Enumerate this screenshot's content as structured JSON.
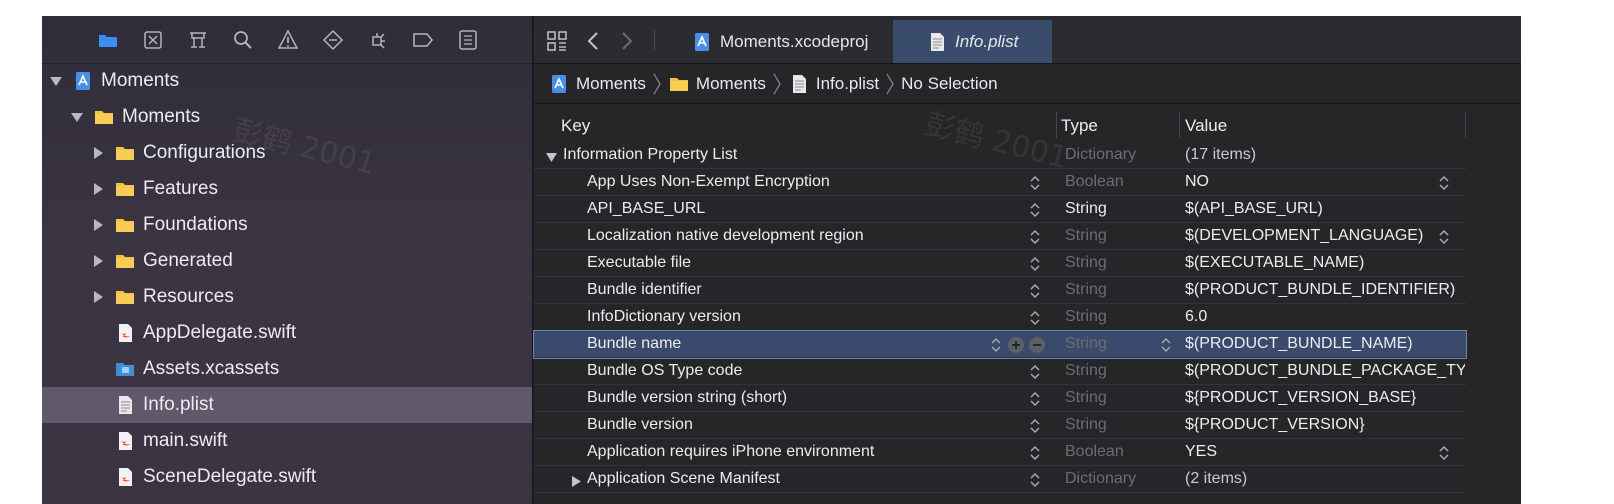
{
  "navigator": {
    "toolbar_icons": [
      "folder-icon",
      "source-control-icon",
      "symbol-icon",
      "find-icon",
      "issue-warning-icon",
      "test-icon",
      "debug-icon",
      "breakpoint-icon",
      "report-icon"
    ],
    "tree": [
      {
        "label": "Moments",
        "icon": "project-icon",
        "expanded": true,
        "level": 0
      },
      {
        "label": "Moments",
        "icon": "folder-icon",
        "expanded": true,
        "level": 1
      },
      {
        "label": "Configurations",
        "icon": "folder-icon",
        "expanded": false,
        "level": 2
      },
      {
        "label": "Features",
        "icon": "folder-icon",
        "expanded": false,
        "level": 2
      },
      {
        "label": "Foundations",
        "icon": "folder-icon",
        "expanded": false,
        "level": 2
      },
      {
        "label": "Generated",
        "icon": "folder-icon",
        "expanded": false,
        "level": 2
      },
      {
        "label": "Resources",
        "icon": "folder-icon",
        "expanded": false,
        "level": 2
      },
      {
        "label": "AppDelegate.swift",
        "icon": "swift-file-icon",
        "level": 2
      },
      {
        "label": "Assets.xcassets",
        "icon": "asset-catalog-icon",
        "level": 2
      },
      {
        "label": "Info.plist",
        "icon": "plist-file-icon",
        "level": 2,
        "selected": true
      },
      {
        "label": "main.swift",
        "icon": "swift-file-icon",
        "level": 2
      },
      {
        "label": "SceneDelegate.swift",
        "icon": "swift-file-icon",
        "level": 2
      }
    ],
    "watermark": "彭鹤 2001"
  },
  "editor": {
    "tabs": [
      {
        "label": "Moments.xcodeproj",
        "icon": "project-icon",
        "active": false
      },
      {
        "label": "Info.plist",
        "icon": "plist-file-icon",
        "active": true
      }
    ],
    "jump_bar": [
      {
        "label": "Moments",
        "icon": "project-icon"
      },
      {
        "label": "Moments",
        "icon": "folder-icon"
      },
      {
        "label": "Info.plist",
        "icon": "plist-file-icon"
      },
      {
        "label": "No Selection",
        "icon": ""
      }
    ],
    "plist": {
      "columns": {
        "key": "Key",
        "type": "Type",
        "value": "Value"
      },
      "rows": [
        {
          "key": "Information Property List",
          "type": "Dictionary",
          "value": "(17 items)",
          "root": true,
          "type_dim": true,
          "value_dim": true
        },
        {
          "key": "App Uses Non-Exempt Encryption",
          "type": "Boolean",
          "value": "NO",
          "type_dim": true,
          "value_stepper": true
        },
        {
          "key": "API_BASE_URL",
          "type": "String",
          "value": "$(API_BASE_URL)",
          "type_dim": false
        },
        {
          "key": "Localization native development region",
          "type": "String",
          "value": "$(DEVELOPMENT_LANGUAGE)",
          "type_dim": true,
          "value_stepper": true
        },
        {
          "key": "Executable file",
          "type": "String",
          "value": "$(EXECUTABLE_NAME)",
          "type_dim": true
        },
        {
          "key": "Bundle identifier",
          "type": "String",
          "value": "$(PRODUCT_BUNDLE_IDENTIFIER)",
          "type_dim": true
        },
        {
          "key": "InfoDictionary version",
          "type": "String",
          "value": "6.0",
          "type_dim": true
        },
        {
          "key": "Bundle name",
          "type": "String",
          "value": "$(PRODUCT_BUNDLE_NAME)",
          "type_dim": true,
          "selected": true
        },
        {
          "key": "Bundle OS Type code",
          "type": "String",
          "value": "$(PRODUCT_BUNDLE_PACKAGE_TY",
          "type_dim": true
        },
        {
          "key": "Bundle version string (short)",
          "type": "String",
          "value": "${PRODUCT_VERSION_BASE}",
          "type_dim": true
        },
        {
          "key": "Bundle version",
          "type": "String",
          "value": "${PRODUCT_VERSION}",
          "type_dim": true
        },
        {
          "key": "Application requires iPhone environment",
          "type": "Boolean",
          "value": "YES",
          "type_dim": true,
          "value_stepper": true
        },
        {
          "key": "Application Scene Manifest",
          "type": "Dictionary",
          "value": "(2 items)",
          "type_dim": true,
          "value_dim": true,
          "collapsed": true
        }
      ]
    },
    "watermark": "彭鹤 2001"
  },
  "colors": {
    "folder": "#f5c242",
    "selection": "#3a4a6c",
    "accent_blue": "#3b8ff0"
  }
}
